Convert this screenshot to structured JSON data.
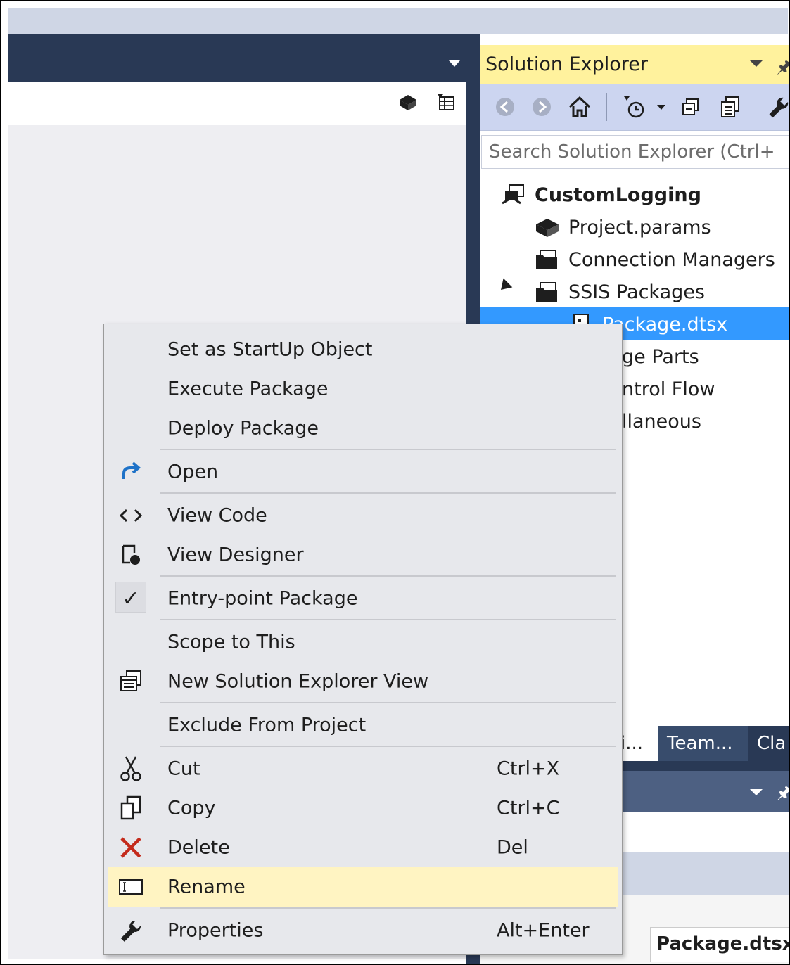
{
  "solution_explorer": {
    "title": "Solution Explorer",
    "search_placeholder": "Search Solution Explorer (Ctrl+",
    "tree": {
      "project": "CustomLogging",
      "project_params": "Project.params",
      "connection_managers": "Connection Managers",
      "ssis_packages": "SSIS Packages",
      "package_selected": "Package.dtsx",
      "package_parts_partial": "ge Parts",
      "control_flow_partial": "ntrol Flow",
      "miscellaneous_partial": "llaneous"
    }
  },
  "bottom_tabs": {
    "tab1": "i...",
    "tab2": "Team...",
    "tab3": "Cla"
  },
  "properties_panel": {
    "object_name": "Package.dtsx"
  },
  "context_menu": {
    "set_startup": "Set as StartUp Object",
    "execute_package": "Execute Package",
    "deploy_package": "Deploy Package",
    "open": "Open",
    "view_code": "View Code",
    "view_designer": "View Designer",
    "entry_point": "Entry-point Package",
    "scope_to_this": "Scope to This",
    "new_se_view": "New Solution Explorer View",
    "exclude": "Exclude From Project",
    "cut": "Cut",
    "cut_shortcut": "Ctrl+X",
    "copy": "Copy",
    "copy_shortcut": "Ctrl+C",
    "delete": "Delete",
    "delete_shortcut": "Del",
    "rename": "Rename",
    "properties": "Properties",
    "properties_shortcut": "Alt+Enter"
  },
  "colors": {
    "title_dark": "#293955",
    "se_title_yellow": "#fff29d",
    "selection_blue": "#3399ff",
    "menu_bg": "#e7e8ec",
    "menu_highlight": "#fff4c2",
    "delete_red": "#c42b1c",
    "open_blue": "#1e72c8"
  }
}
